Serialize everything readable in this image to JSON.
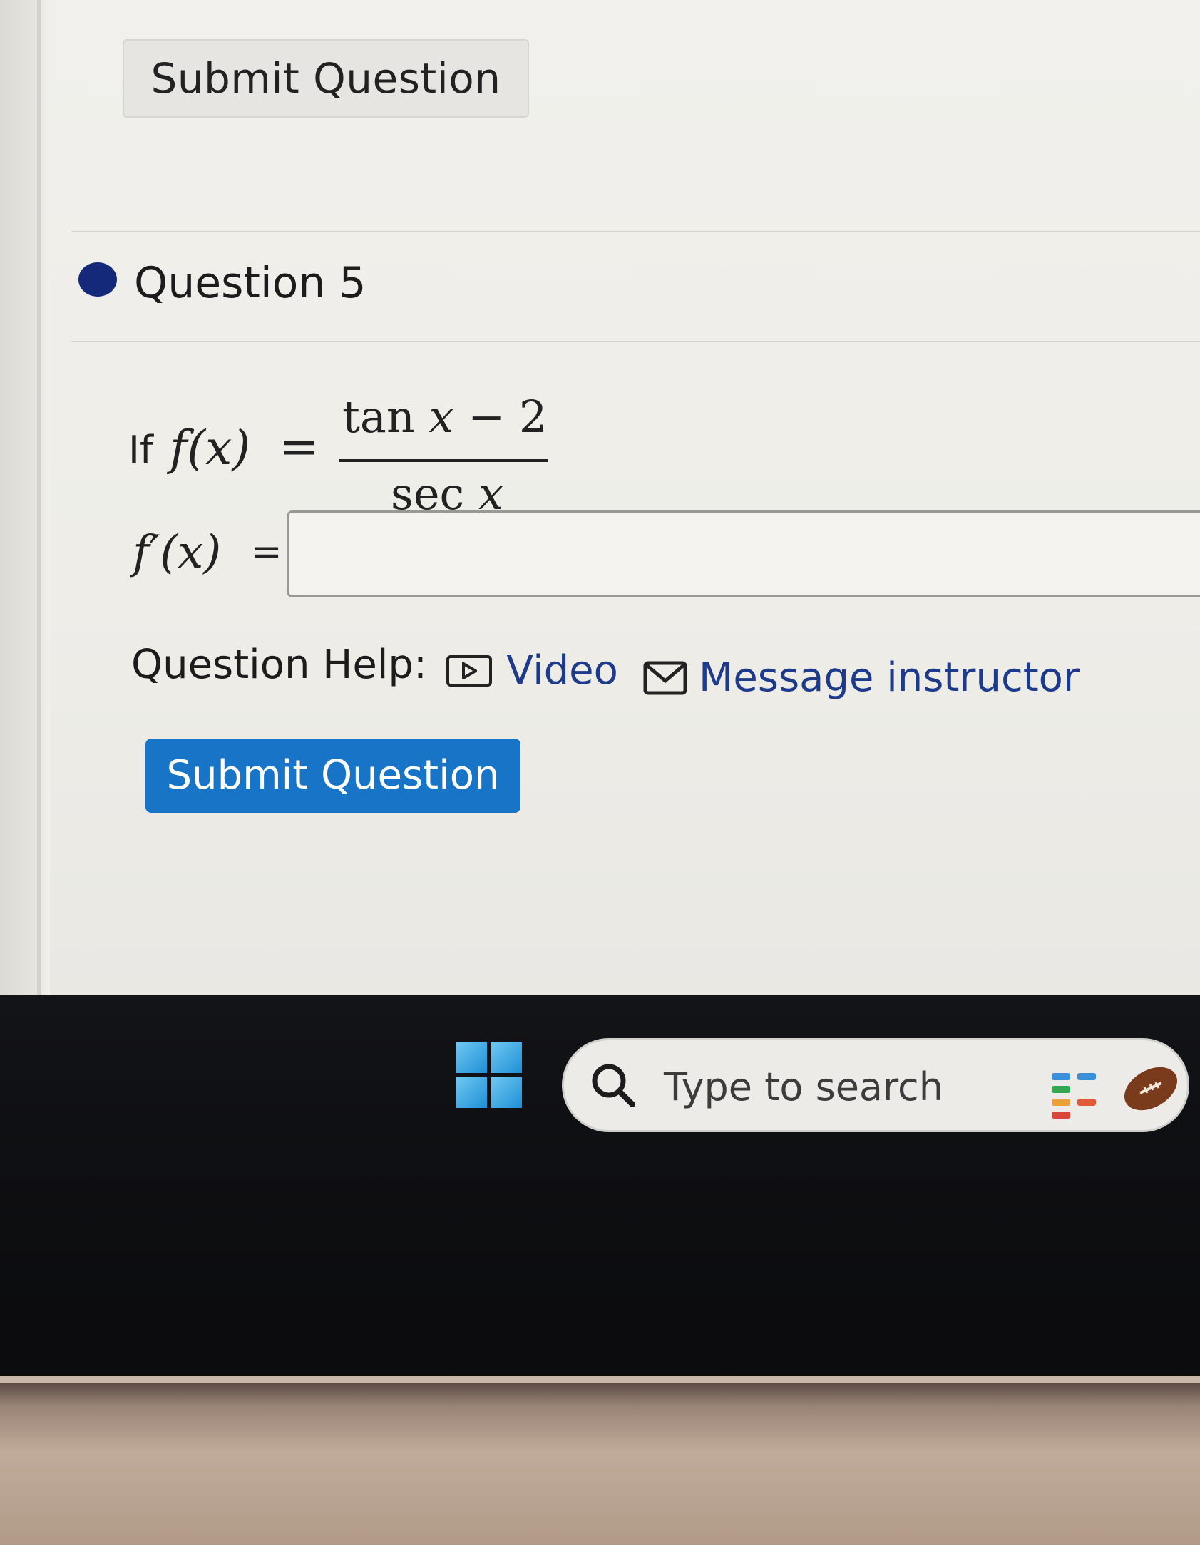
{
  "buttons": {
    "submit_top": "Submit Question",
    "submit_main": "Submit Question"
  },
  "question": {
    "title": "Question 5",
    "if_label": "If",
    "function_lhs": "f(x)",
    "equals": "=",
    "numerator_func": "tan",
    "numerator_var": "x",
    "numerator_rest": " − 2",
    "denominator_func": "sec",
    "denominator_var": "x",
    "derivative_lhs": "f′(x)",
    "answer_equals": "=",
    "answer_value": ""
  },
  "help": {
    "label": "Question Help:",
    "video_label": "Video",
    "message_label": "Message instructor"
  },
  "taskbar": {
    "search_placeholder": "Type to search"
  },
  "colors": {
    "primary_button": "#1874c6",
    "link": "#1e3a8a",
    "bullet": "#15297a",
    "taskbar": "#0e0f12"
  },
  "icons": [
    "play-icon",
    "mail-icon",
    "windows-icon",
    "search-icon",
    "widgets-icon",
    "football-icon"
  ]
}
